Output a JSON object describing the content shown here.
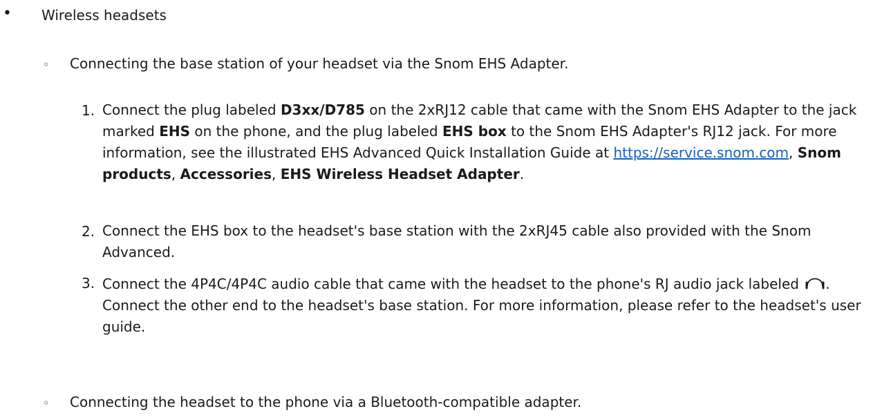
{
  "wireless": {
    "bullet": "•",
    "heading": "Wireless headsets"
  },
  "ehs": {
    "bullet": "◦",
    "heading": "Connecting the base station of your headset via the Snom EHS Adapter.",
    "step1": {
      "num": "1.",
      "t1": "Connect the plug labeled ",
      "b1": "D3xx/D785",
      "t2": " on the 2xRJ12 cable that came with the Snom EHS Adapter to the jack marked ",
      "b2": "EHS",
      "t3": " on the phone, and the plug labeled ",
      "b3": "EHS box",
      "t4": " to the Snom EHS Adapter's RJ12 jack.  For more information, see the illustrated EHS Advanced Quick Installation Guide at ",
      "link": "https://service.snom.com",
      "t5": ", ",
      "b4": "Snom products",
      "t6": ",  ",
      "b5": "Accessories",
      "t7": ", ",
      "b6": "EHS Wireless Headset Adapter",
      "t8": "."
    },
    "step2": {
      "num": "2.",
      "text": "Connect the EHS box to the headset's base station with the 2xRJ45 cable also provided with the Snom Advanced."
    },
    "step3": {
      "num": "3.",
      "t1": "Connect the 4P4C/4P4C audio cable that came with the headset to the phone's RJ audio jack labeled ",
      "icon": "headset-icon",
      "t2": ".  Connect the other end to the headset's base station.  For more information, please refer to the headset's user guide."
    }
  },
  "bluetooth": {
    "bullet": "◦",
    "heading": "Connecting the headset to the phone via a Bluetooth-compatible adapter."
  }
}
